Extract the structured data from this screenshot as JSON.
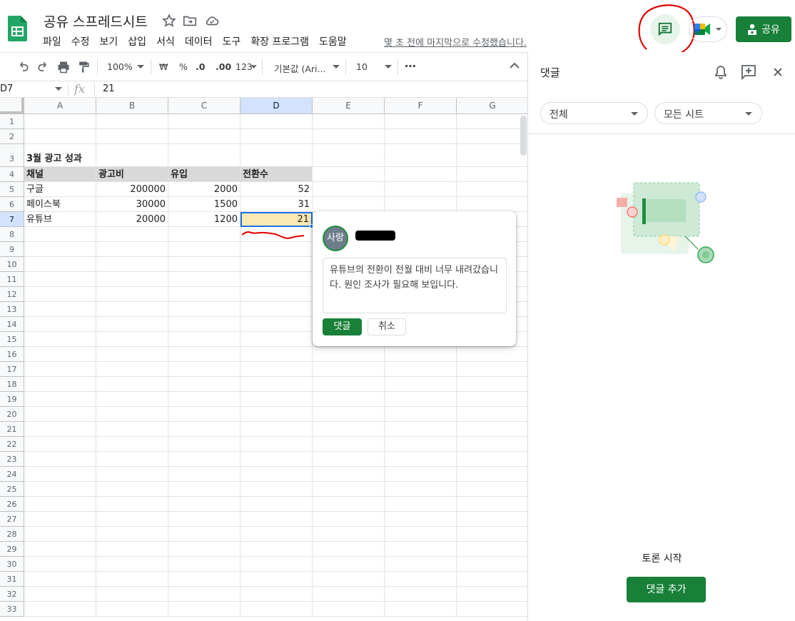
{
  "app": {
    "doc_title": "공유 스프레드시트",
    "menu": [
      "파일",
      "수정",
      "보기",
      "삽입",
      "서식",
      "데이터",
      "도구",
      "확장 프로그램",
      "도움말"
    ],
    "last_edit": "몇 초 전에 마지막으로 수정했습니다.",
    "share_label": "공유"
  },
  "toolbar": {
    "zoom": "100%",
    "currency": "₩",
    "percent": "%",
    "dec_decrease": ".0",
    "dec_increase": ".00",
    "number_format": "123",
    "font": "기본값 (Ari...",
    "font_size": "10",
    "more": "⋯"
  },
  "formula_bar": {
    "name_box": "D7",
    "fx": "fx",
    "value": "21"
  },
  "grid": {
    "columns": [
      "A",
      "B",
      "C",
      "D",
      "E",
      "F",
      "G"
    ],
    "rows": [
      "1",
      "2",
      "3",
      "4",
      "5",
      "6",
      "7",
      "8",
      "9",
      "10",
      "11",
      "12",
      "13",
      "14",
      "15",
      "16",
      "17",
      "18",
      "19",
      "20",
      "21",
      "22",
      "23",
      "24",
      "25",
      "26",
      "27",
      "28",
      "29",
      "30",
      "31",
      "32",
      "33"
    ],
    "title": "3월 광고 성과",
    "headers": [
      "채널",
      "광고비",
      "유입",
      "전환수"
    ],
    "data": [
      [
        "구글",
        "200000",
        "2000",
        "52"
      ],
      [
        "페이스북",
        "30000",
        "1500",
        "31"
      ],
      [
        "유튜브",
        "20000",
        "1200",
        "21"
      ]
    ]
  },
  "comment_popup": {
    "avatar_text": "사랑",
    "text": "유튜브의 전환이 전월 대비 너무 내려갔습니다. 원인 조사가 필요해 보입니다.",
    "submit_label": "댓글",
    "cancel_label": "취소"
  },
  "panel": {
    "title": "댓글",
    "filter_all": "전체",
    "filter_sheets": "모든 시트",
    "start_label": "토론 시작",
    "add_comment_label": "댓글 추가"
  },
  "colors": {
    "brand_green": "#188038",
    "selection_fill": "#fce8b2",
    "selection_border": "#1a73e8",
    "annotation_red": "#e00000"
  }
}
